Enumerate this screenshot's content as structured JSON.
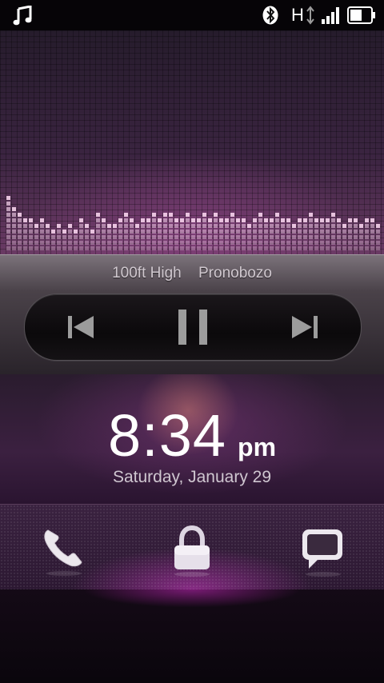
{
  "status_bar": {
    "icons": [
      "music-note-icon",
      "bluetooth-icon",
      "hspa-data-icon",
      "signal-strength-icon",
      "battery-icon"
    ],
    "network_type": "H"
  },
  "now_playing": {
    "track": "100ft High",
    "artist": "Pronobozo"
  },
  "controls": {
    "icons": [
      "previous-track-icon",
      "pause-icon",
      "next-track-icon"
    ]
  },
  "lock_clock": {
    "time": "8:34",
    "ampm": "pm",
    "date": "Saturday, January 29"
  },
  "dock": {
    "icons": [
      "phone-icon",
      "lock-icon",
      "message-icon"
    ]
  },
  "colors": {
    "accent": "#d23ccb",
    "background": "#1a0f1f"
  }
}
